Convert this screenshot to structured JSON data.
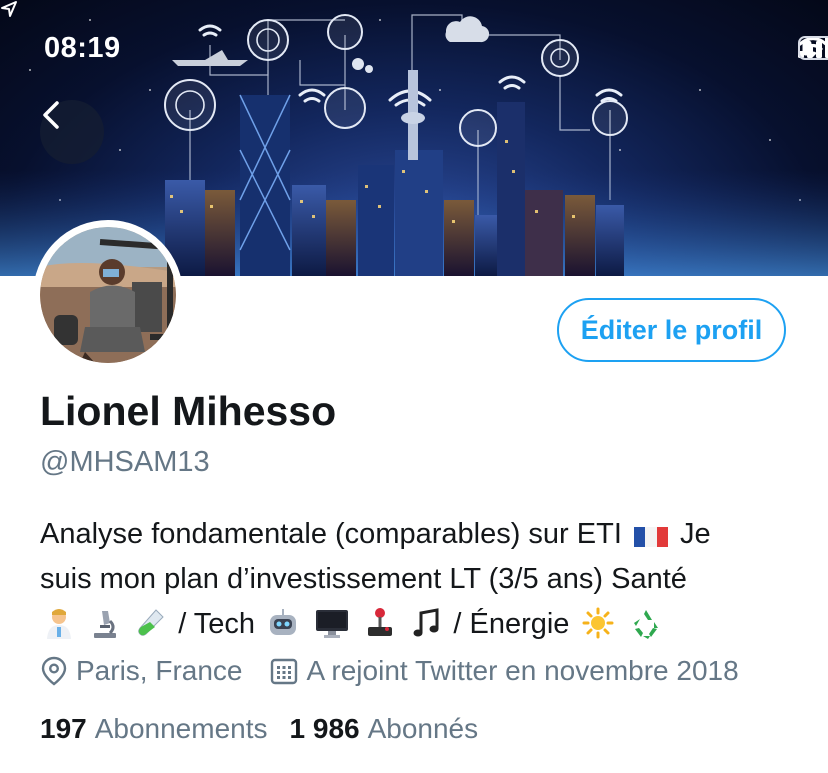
{
  "status_bar": {
    "time": "08:19",
    "icons": [
      "location-arrow-icon",
      "signal-icon",
      "wifi-icon",
      "battery-icon"
    ]
  },
  "header": {
    "back_icon": "chevron-left-icon"
  },
  "profile": {
    "edit_label": "Éditer le profil",
    "display_name": "Lionel Mihesso",
    "handle": "@MHSAM13",
    "bio_line1_text": "Analyse fondamentale (comparables) sur ETI",
    "bio_line1_end": "Je",
    "bio_line2": "suis mon plan d’investissement LT (3/5 ans) Santé",
    "bio_line3_tech": "/ Tech",
    "bio_line3_energy": "/ Énergie",
    "emojis": {
      "line1": [
        "france-flag-icon"
      ],
      "line3_sante": [
        "health-worker-icon",
        "microscope-icon",
        "test-tube-icon"
      ],
      "line3_tech": [
        "robot-icon",
        "desktop-computer-icon",
        "joystick-icon",
        "music-note-icon"
      ],
      "line3_energy": [
        "sun-icon",
        "recycle-icon"
      ]
    },
    "location": "Paris, France",
    "joined": "A rejoint Twitter en novembre 2018",
    "following_count": "197",
    "following_label": "Abonnements",
    "followers_count": "1 986",
    "followers_label": "Abonnés"
  },
  "colors": {
    "accent": "#1da1f2",
    "secondary_text": "#657786",
    "primary_text": "#14171a"
  }
}
